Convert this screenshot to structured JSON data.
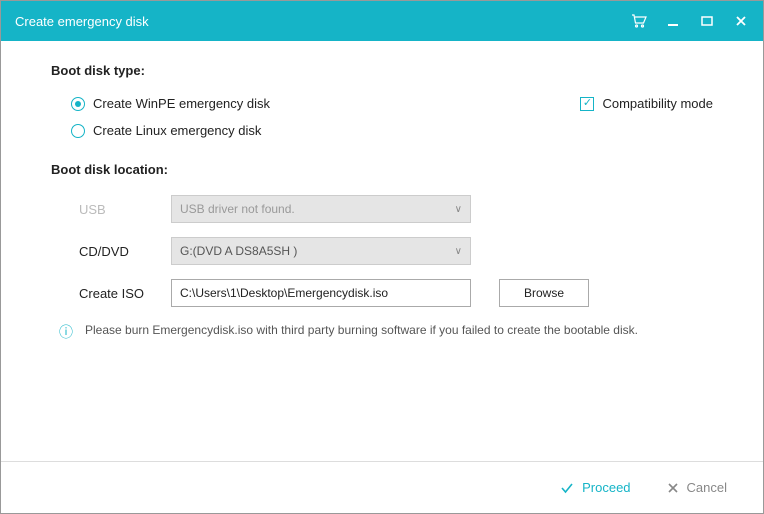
{
  "titlebar": {
    "title": "Create emergency disk"
  },
  "section1": {
    "label": "Boot disk type:",
    "opt1": "Create WinPE emergency disk",
    "opt2": "Create Linux emergency disk",
    "compat": "Compatibility mode"
  },
  "section2": {
    "label": "Boot disk location:",
    "usb_label": "USB",
    "usb_value": "USB driver not found.",
    "cd_label": "CD/DVD",
    "cd_value": "G:(DVD A DS8A5SH   )",
    "iso_label": "Create ISO",
    "iso_value": "C:\\Users\\1\\Desktop\\Emergencydisk.iso",
    "browse": "Browse"
  },
  "note": "Please burn Emergencydisk.iso with third party burning software if you failed to create the bootable disk.",
  "footer": {
    "proceed": "Proceed",
    "cancel": "Cancel"
  }
}
